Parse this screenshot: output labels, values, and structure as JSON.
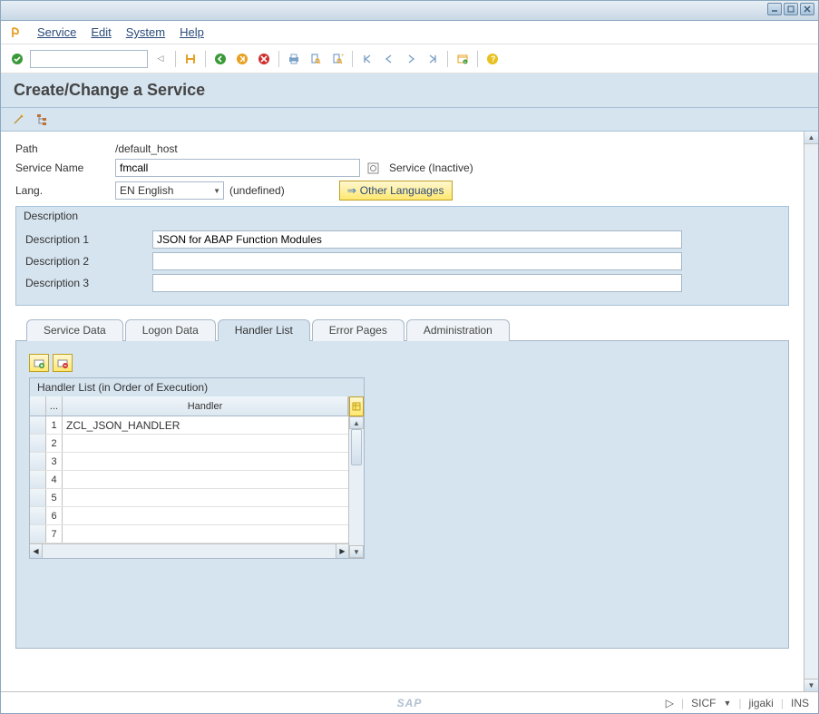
{
  "menubar": {
    "items": [
      "Service",
      "Edit",
      "System",
      "Help"
    ]
  },
  "header": {
    "title": "Create/Change a Service"
  },
  "fields": {
    "path_label": "Path",
    "path_value": "/default_host",
    "service_name_label": "Service Name",
    "service_name_value": "fmcall",
    "service_status": "Service (Inactive)",
    "lang_label": "Lang.",
    "lang_value": "EN  English",
    "lang_undef": "(undefined)",
    "other_lang_btn": "Other Languages"
  },
  "description": {
    "group_title": "Description",
    "d1_label": "Description 1",
    "d1_value": "JSON for ABAP Function Modules",
    "d2_label": "Description 2",
    "d2_value": "",
    "d3_label": "Description 3",
    "d3_value": ""
  },
  "tabs": {
    "items": [
      "Service Data",
      "Logon Data",
      "Handler List",
      "Error Pages",
      "Administration"
    ],
    "active": 2
  },
  "handler_table": {
    "group_title": "Handler List (in Order of Execution)",
    "header_num": "...",
    "header_handler": "Handler",
    "rows": [
      {
        "num": "1",
        "handler": "ZCL_JSON_HANDLER"
      },
      {
        "num": "2",
        "handler": ""
      },
      {
        "num": "3",
        "handler": ""
      },
      {
        "num": "4",
        "handler": ""
      },
      {
        "num": "5",
        "handler": ""
      },
      {
        "num": "6",
        "handler": ""
      },
      {
        "num": "7",
        "handler": ""
      }
    ]
  },
  "statusbar": {
    "tcode": "SICF",
    "user": "jigaki",
    "mode": "INS"
  }
}
